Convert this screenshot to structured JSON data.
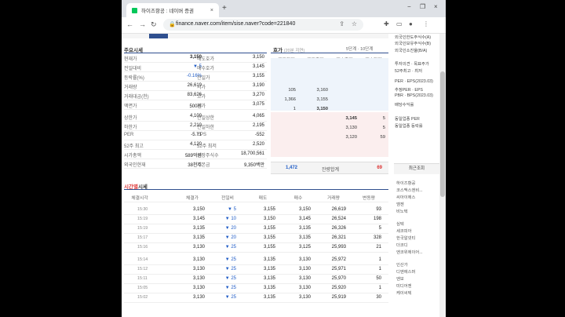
{
  "browser": {
    "tab_title": "하이즈항공 : 네이버 증권",
    "tab_close": "×",
    "new_tab": "+",
    "url": "finance.naver.com/item/sise.naver?code=221840",
    "back": "←",
    "forward": "→",
    "reload": "↻",
    "lock": "🔒",
    "share": "⇪",
    "star": "☆",
    "minimize": "−",
    "restore": "❐",
    "close": "×",
    "extensions": "✚",
    "menu": "⋮",
    "sidebar_toggle": "▭",
    "profile": "●"
  },
  "sidebar": {
    "lines": [
      "외국인한도주식수(A)",
      "외국인보유주식수(B)",
      "외국인소진율(B/A)",
      "투자의견 · 목표주가",
      "52주최고 · 최저",
      "PER · EPS(2023.03)",
      "추정PER · EPS",
      "PBR · BPS(2023.03)",
      "배당수익률",
      "동일업종 PER",
      "동일업종 등락률"
    ],
    "recent_title": "최근조회",
    "recent": [
      "하이즈항공",
      "코스맥스엔비...",
      "씨아이에스",
      "엠젠",
      "비노텍",
      "심텍",
      "세코피아",
      "한국알넷티",
      "더코디",
      "엔코위에이어...",
      "인산가",
      "디엔에스머",
      "엔보",
      "미디어젠",
      "케이씨텍"
    ]
  },
  "quote": {
    "title": "주요시세",
    "rows": [
      {
        "l1": "현재가",
        "v1": "3,150",
        "l2": "매도호가",
        "v2": "3,150"
      },
      {
        "l1": "전일대비",
        "v1": "▼ 5",
        "l2": "매수호가",
        "v2": "3,145"
      },
      {
        "l1": "등락률(%)",
        "v1": "-0.16%",
        "l2": "전일가",
        "v2": "3,155"
      },
      {
        "l1": "거래량",
        "v1": "26,619",
        "l2": "시가",
        "v2": "3,190"
      },
      {
        "l1": "거래대금(천)",
        "v1": "83,626",
        "l2": "고가",
        "v2": "3,270"
      },
      {
        "l1": "액면가",
        "v1": "500원",
        "l2": "저가",
        "v2": "3,075"
      },
      {
        "l1": "상한가",
        "v1": "4,100",
        "l2": "전일상한",
        "v2": "4,065"
      },
      {
        "l1": "하한가",
        "v1": "2,210",
        "l2": "전일하한",
        "v2": "2,195"
      },
      {
        "l1": "PER",
        "v1": "-5.71",
        "l2": "EPS",
        "v2": "-552"
      },
      {
        "l1": "52주 최고",
        "v1": "4,120",
        "l2": "52주 최저",
        "v2": "2,520"
      },
      {
        "l1": "시가총액",
        "v1": "589억원",
        "l2": "상장주식수",
        "v2": "18,700,561"
      },
      {
        "l1": "외국인현재",
        "v1": "38천주",
        "l2": "자본금",
        "v2": "9,350백만"
      }
    ]
  },
  "hoga": {
    "title": "호가",
    "subtitle": "(20분 지연)",
    "option": "5단계 · 10단계",
    "headers": [
      "매도잔량",
      "매도호가",
      "매수호가",
      "매수잔량"
    ],
    "ask": [
      {
        "qty": "105",
        "price": "3,160"
      },
      {
        "qty": "1,366",
        "price": "3,155"
      },
      {
        "qty": "1",
        "price": "3,150"
      }
    ],
    "bid": [
      {
        "price": "3,145",
        "qty": "5"
      },
      {
        "price": "3,130",
        "qty": "5"
      },
      {
        "price": "3,120",
        "qty": "59"
      }
    ],
    "total_ask": "1,472",
    "total_label": "잔량합계",
    "total_bid": "69"
  },
  "timeseries": {
    "title_red": "시간별",
    "title": "시세",
    "headers": [
      "체결시각",
      "체결가",
      "전일비",
      "매도",
      "매수",
      "거래량",
      "변동량"
    ],
    "rows": [
      [
        "15:30",
        "3,150",
        "▼ 5",
        "3,155",
        "3,150",
        "26,619",
        "93"
      ],
      [
        "15:19",
        "3,145",
        "▼ 10",
        "3,150",
        "3,145",
        "26,524",
        "198"
      ],
      [
        "15:19",
        "3,135",
        "▼ 20",
        "3,155",
        "3,135",
        "26,326",
        "5"
      ],
      [
        "15:17",
        "3,135",
        "▼ 20",
        "3,155",
        "3,135",
        "26,321",
        "328"
      ],
      [
        "15:16",
        "3,130",
        "▼ 25",
        "3,155",
        "3,125",
        "25,993",
        "21"
      ],
      [
        "15:14",
        "3,130",
        "▼ 25",
        "3,135",
        "3,130",
        "25,972",
        "1"
      ],
      [
        "15:12",
        "3,130",
        "▼ 25",
        "3,135",
        "3,130",
        "25,971",
        "1"
      ],
      [
        "15:11",
        "3,130",
        "▼ 25",
        "3,135",
        "3,130",
        "25,970",
        "50"
      ],
      [
        "15:05",
        "3,130",
        "▼ 25",
        "3,135",
        "3,130",
        "25,920",
        "1"
      ],
      [
        "15:02",
        "3,130",
        "▼ 25",
        "3,135",
        "3,130",
        "25,919",
        "30"
      ]
    ]
  }
}
